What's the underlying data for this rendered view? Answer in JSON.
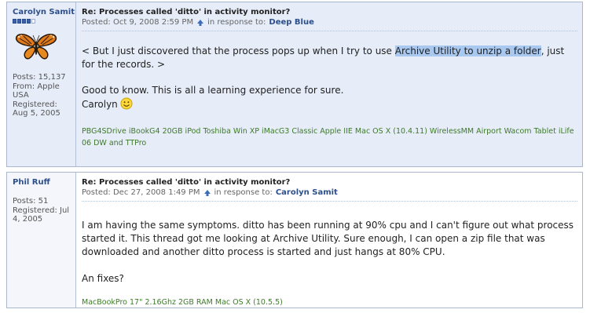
{
  "posts": [
    {
      "author": "Carolyn Samit",
      "rank_filled": 4,
      "rank_total": 5,
      "stats": [
        "Posts: 15,137",
        "From: Apple",
        "USA",
        "Registered:",
        "Aug 5, 2005"
      ],
      "subject": "Re: Processes called 'ditto' in activity monitor?",
      "posted": "Posted: Oct 9, 2008 2:59 PM",
      "in_response": "in response to:",
      "reply_to": "Deep Blue",
      "quote_pre": "< But I just discovered that the process pops up when I try to use ",
      "quote_highlight": "Archive Utility to unzip a folder",
      "quote_post": ", just for the records. >",
      "line2": "Good to know. This is all a learning experience for sure.",
      "line3": "Carolyn",
      "signature": "PBG4SDrive iBookG4 20GB iPod Toshiba Win XP iMacG3 Classic Apple IIE   Mac OS X (10.4.11)   WirelessMM Airport Wacom Tablet iLife 06 DW and TTPro"
    },
    {
      "author": "Phil Ruff",
      "stats": [
        "Posts: 51",
        "Registered: Jul",
        "4, 2005"
      ],
      "subject": "Re: Processes called 'ditto' in activity monitor?",
      "posted": "Posted: Dec 27, 2008 1:49 PM",
      "in_response": "in response to:",
      "reply_to": "Carolyn Samit",
      "para1": "I am having the same symptoms. ditto has been running at 90% cpu and I can't figure out what process started it. This thread got me looking at Archive Utility. Sure enough, I can open a zip file that was downloaded and another ditto process is started and just hangs at 80% CPU.",
      "para2": "An fixes?",
      "signature": "MacBookPro 17\" 2.16Ghz 2GB RAM   Mac OS X (10.5.5)"
    }
  ],
  "colors": {
    "post1_bg": "#e6ecf8",
    "link": "#2c4f8c",
    "signature": "#3e7a2a",
    "highlight": "#a8c8f0"
  }
}
